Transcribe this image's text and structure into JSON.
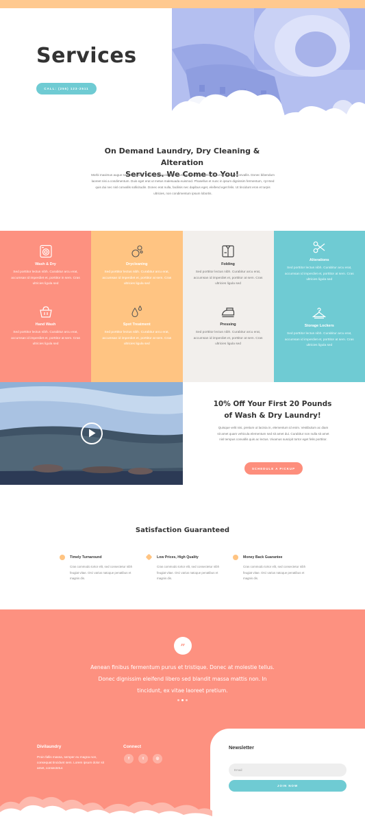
{
  "colors": {
    "top_bar": "#ffc98f",
    "coral": "#fd9180",
    "peach": "#ffc482",
    "cream": "#f2efec",
    "teal": "#6fcbd3",
    "button_coral": "#fd8e7c"
  },
  "hero": {
    "title": "Services",
    "call_button": "CALL: (255) 123-2511"
  },
  "intro": {
    "title_line1": "On Demand Laundry, Dry Cleaning & Alteration",
    "title_line2": "Services. We Come to You!",
    "text": "Morbi maximus augue sed dui cursus, ut amet vehicula nisl varius. Vestibulum porttitor id purus tincidunt convallis. Donec bibendum laoreet nisi a condimentum. Duis eget erat ut metus malesuada euismod. Phasellus et nunc in ipsum dignissim fermentum, <p>Sed quis dui nec nisl convallis sollicitudin. Donec erat nulla, facilisis nec dapibus eget, eleifend eget felis. Ut tincidunt eros et turpis ultricies, non condimentum ipsum lobortis."
  },
  "services": [
    {
      "name": "Wash & Dry",
      "icon": "washing-machine-icon",
      "desc": "Sed porttitor lectus nibh. Curabitur arcu erat, accumsan id imperdiet et, porttitor in sem. Cras ultricies ligula sed"
    },
    {
      "name": "Hand Wash",
      "icon": "basket-icon",
      "desc": "Sed porttitor lectus nibh. Curabitur arcu erat, accumsan id imperdiet et, porttitor at sem. Cras ultricies ligula sed"
    },
    {
      "name": "Drycleaning",
      "icon": "bubbles-icon",
      "desc": "Sed porttitor lectus nibh. Curabitur arcu erat, accumsan id imperdiet et, porttitor at sem. Cras ultricies ligula sed"
    },
    {
      "name": "Spot Treatment",
      "icon": "drops-icon",
      "desc": "Sed porttitor lectus nibh. Curabitur arcu erat, accumsan id imperdiet et, porttitor at sem. Cras ultricies ligula sed"
    },
    {
      "name": "Folding",
      "icon": "folded-shirt-icon",
      "desc": "Sed porttitor lectus nibh. Curabitur arcu erat, accumsan id imperdiet et, porttitor at sem. Cras ultricies ligula sed"
    },
    {
      "name": "Pressing",
      "icon": "iron-icon",
      "desc": "Sed porttitor lectus nibh. Curabitur arcu erat, accumsan id imperdiet et, porttitor at sem. Cras ultricies ligula sed"
    },
    {
      "name": "Alterations",
      "icon": "scissors-icon",
      "desc": "Sed porttitor lectus nibh. Curabitur arcu erat, accumsan id imperdiet et, porttitor at sem. Cras ultricies ligula sed"
    },
    {
      "name": "Storage Lockers",
      "icon": "hanger-icon",
      "desc": "Sed porttitor lectus nibh. Curabitur arcu erat, accumsan id imperdiet et, porttitor at sem. Cras ultricies ligula sed"
    }
  ],
  "promo": {
    "title_line1": "10% Off Your First 20 Pounds",
    "title_line2": "of Wash & Dry Laundry!",
    "text": "Quisque velit nisi, pretium ut lacinia in, elementum id enim. Vestibulum ac diam sit amet quam vehicula elementum sed sit amet dui. Curabitur non nulla sit amet nisl tempus convallis quis ac lectus. Vivamus suscipit tortor eget felis porttitor.",
    "button": "SCHEDULE A PICKUP"
  },
  "satisfaction": {
    "title": "Satisfaction Guaranteed",
    "features": [
      {
        "title": "Timely Turnaround",
        "desc": "Cras commodo tortor elit, sed consectetur nibh feugiat vitae. Orci varius natoque penatibus et magnis dis.",
        "color": "#ffc482"
      },
      {
        "title": "Low Prices, High Quality",
        "desc": "Cras commodo tortor elit, sed consectetur nibh feugiat vitae. Orci varius natoque penatibus et magnis dis.",
        "color": "#ffc482"
      },
      {
        "title": "Money Back Guarantee",
        "desc": "Cras commodo tortor elit, sed consectetur nibh feugiat vitae. Orci varius natoque penatibus et magnis dis.",
        "color": "#ffc482"
      }
    ]
  },
  "testimonial": {
    "quote_mark": "”",
    "line1": "Aenean finibus fermentum purus et tristique. Donec at molestie tellus.",
    "line2": "Donec dignissim eleifend libero sed blandit massa mattis non. In",
    "line3": "tincidunt, ex vitae laoreet pretium."
  },
  "footer": {
    "brand_title": "Divilaundry",
    "brand_text": "Proin fallis massa, semper eu magna non, consequat tincidunt sem. Lorem ipsum dolor sit amet, consectetur.",
    "connect_title": "Connect",
    "social": [
      {
        "icon": "facebook-icon",
        "glyph": "f"
      },
      {
        "icon": "twitter-icon",
        "glyph": "t"
      },
      {
        "icon": "instagram-icon",
        "glyph": "◎"
      }
    ],
    "newsletter_title": "Newsletter",
    "email_placeholder": "Email",
    "join_button": "JOIN NOW"
  }
}
